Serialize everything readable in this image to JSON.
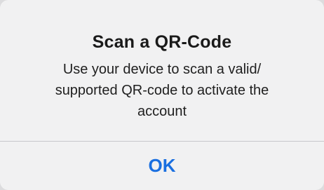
{
  "alert": {
    "title": "Scan a QR-Code",
    "message_line1": "Use your device to scan a valid/",
    "message_line2": "supported QR-code to activate the",
    "message_line3": "account",
    "ok_label": "OK"
  },
  "colors": {
    "accent": "#1a6fe0",
    "alert_background": "#f1f1f2",
    "divider": "#c8c8cb"
  }
}
